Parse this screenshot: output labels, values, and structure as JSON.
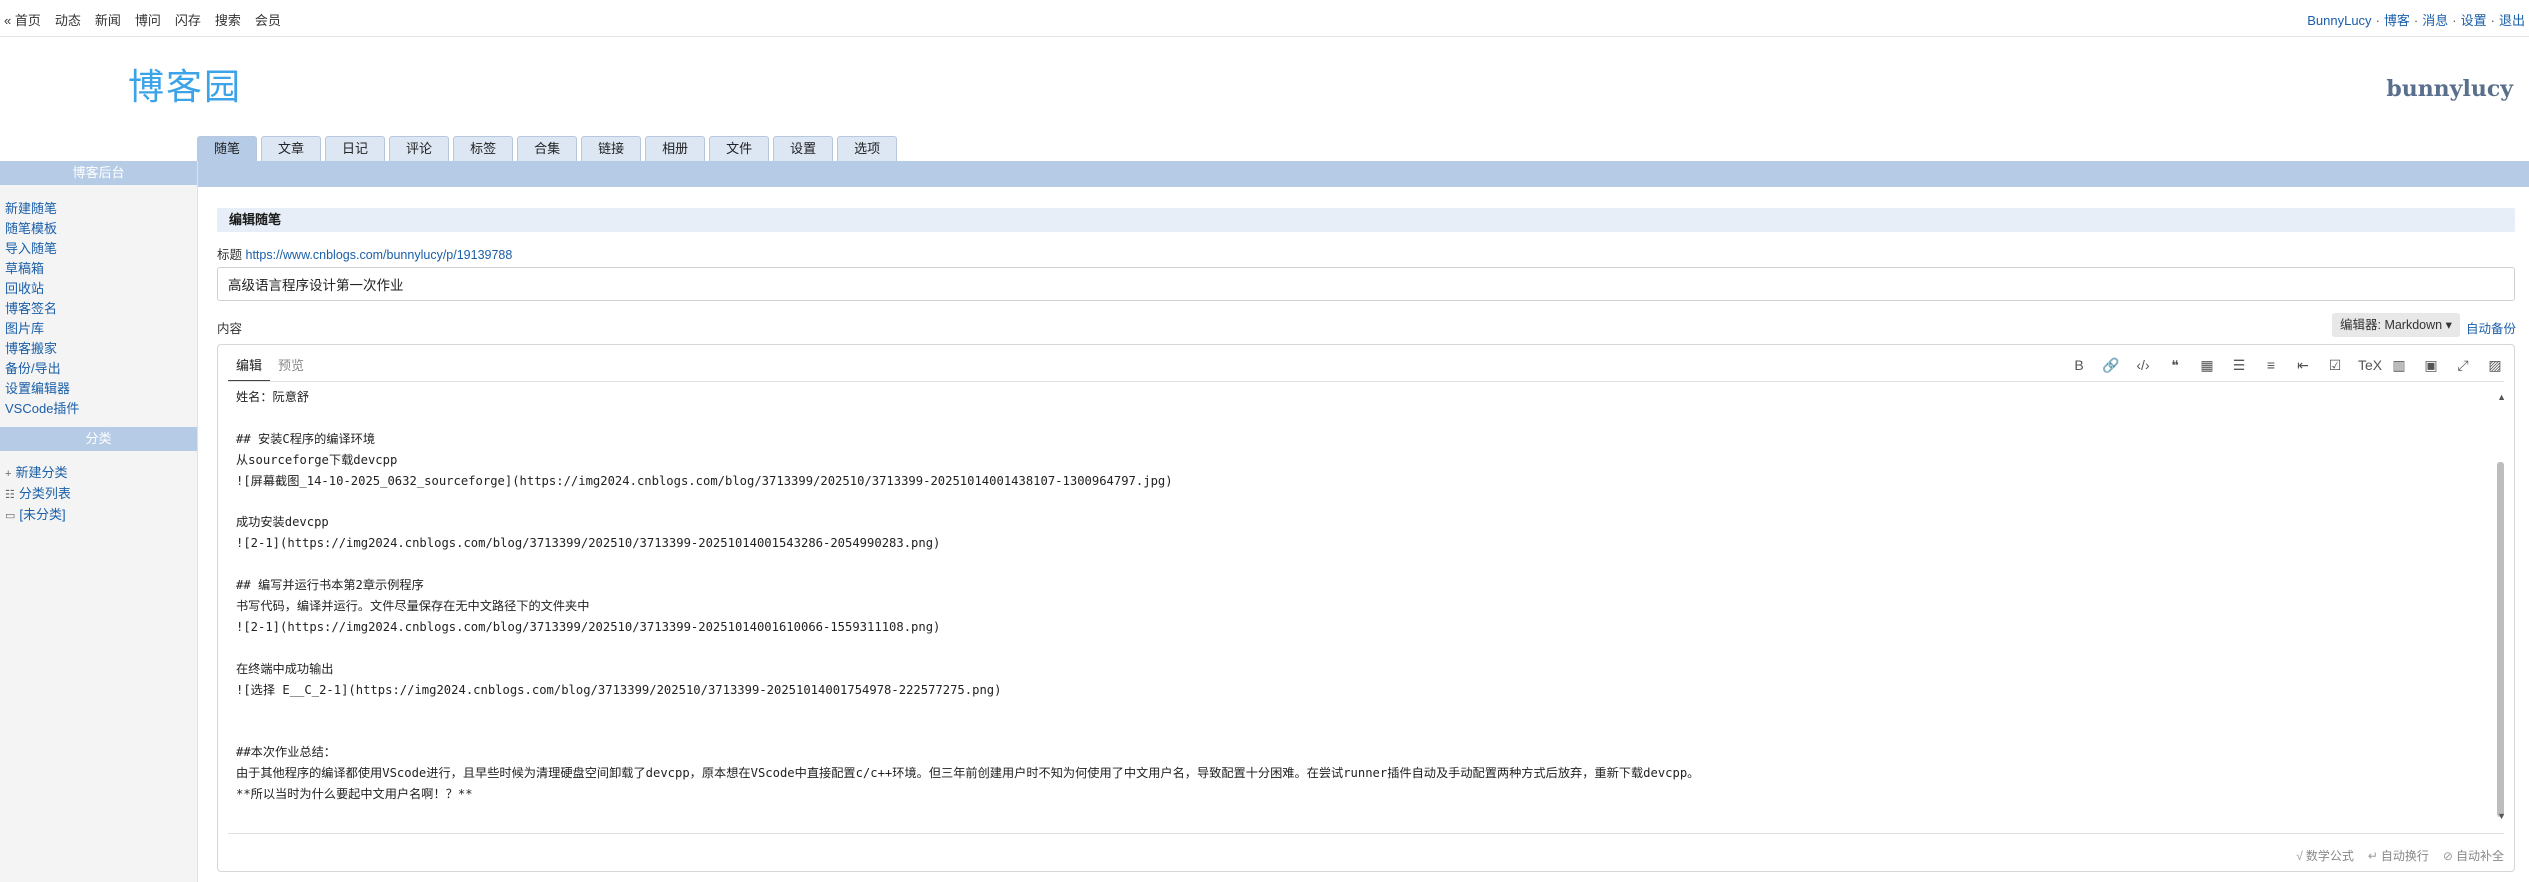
{
  "topbar": {
    "nav": [
      "« 首页",
      "动态",
      "新闻",
      "博问",
      "闪存",
      "搜索",
      "会员"
    ],
    "user": "BunnyLucy",
    "links": [
      "博客",
      "消息",
      "设置",
      "退出"
    ]
  },
  "header": {
    "logo": "博客园",
    "blog_name": "bunnylucy"
  },
  "tabs": [
    "随笔",
    "文章",
    "日记",
    "评论",
    "标签",
    "合集",
    "链接",
    "相册",
    "文件",
    "设置",
    "选项"
  ],
  "sidebar": {
    "title": "博客后台",
    "links": [
      "新建随笔",
      "随笔模板",
      "导入随笔",
      "草稿箱",
      "回收站",
      "博客签名",
      "图片库",
      "博客搬家",
      "备份/导出",
      "设置编辑器",
      "VSCode插件"
    ],
    "category_title": "分类",
    "categories": [
      {
        "icon": "plus-icon",
        "glyph": "+",
        "label": "新建分类"
      },
      {
        "icon": "list-icon",
        "glyph": "☷",
        "label": "分类列表"
      },
      {
        "icon": "folder-icon",
        "glyph": "▭",
        "label": "[未分类]"
      }
    ]
  },
  "main": {
    "panel_title": "编辑随笔",
    "title_label": "标题",
    "title_link": "https://www.cnblogs.com/bunnylucy/p/19139788",
    "title_value": "高级语言程序设计第一次作业",
    "content_label": "内容",
    "editor_select": "编辑器: Markdown ▾",
    "autobackup": "自动备份",
    "editor_tabs": [
      "编辑",
      "预览"
    ],
    "toolbar": [
      {
        "name": "bold-icon",
        "glyph": "B"
      },
      {
        "name": "link-icon",
        "glyph": "🔗"
      },
      {
        "name": "code-icon",
        "glyph": "‹/›"
      },
      {
        "name": "quote-icon",
        "glyph": "❝"
      },
      {
        "name": "table-icon",
        "glyph": "▦"
      },
      {
        "name": "bullet-list-icon",
        "glyph": "☰"
      },
      {
        "name": "ordered-list-icon",
        "glyph": "≡"
      },
      {
        "name": "indent-icon",
        "glyph": "⇤"
      },
      {
        "name": "task-list-icon",
        "glyph": "☑"
      },
      {
        "name": "tex-icon",
        "glyph": "TeX"
      },
      {
        "name": "split-view-icon",
        "glyph": "▥"
      },
      {
        "name": "save-icon",
        "glyph": "▣"
      },
      {
        "name": "fullscreen-icon",
        "glyph": "⤢"
      },
      {
        "name": "image-icon",
        "glyph": "▨"
      }
    ],
    "content_lines": [
      "姓名：阮意舒",
      "",
      "## 安装C程序的编译环境",
      "从sourceforge下载devcpp",
      "![屏幕截图_14-10-2025_0632_sourceforge](https://img2024.cnblogs.com/blog/3713399/202510/3713399-20251014001438107-1300964797.jpg)",
      "",
      "成功安装devcpp",
      "![2-1](https://img2024.cnblogs.com/blog/3713399/202510/3713399-20251014001543286-2054990283.png)",
      "",
      "## 编写并运行书本第2章示例程序",
      "书写代码，编译并运行。文件尽量保存在无中文路径下的文件夹中",
      "![2-1](https://img2024.cnblogs.com/blog/3713399/202510/3713399-20251014001610066-1559311108.png)",
      "",
      "在终端中成功输出",
      "![选择 E__C_2-1](https://img2024.cnblogs.com/blog/3713399/202510/3713399-20251014001754978-222577275.png)",
      "",
      "",
      "##本次作业总结：",
      "由于其他程序的编译都使用VScode进行，且早些时候为清理硬盘空间卸载了devcpp，原本想在VScode中直接配置c/c++环境。但三年前创建用户时不知为何使用了中文用户名，导致配置十分困难。在尝试runner插件自动及手动配置两种方式后放弃，重新下载devcpp。",
      "**所以当时为什么要起中文用户名啊！？**"
    ],
    "status": [
      "数学公式",
      "自动换行",
      "自动补全"
    ]
  }
}
